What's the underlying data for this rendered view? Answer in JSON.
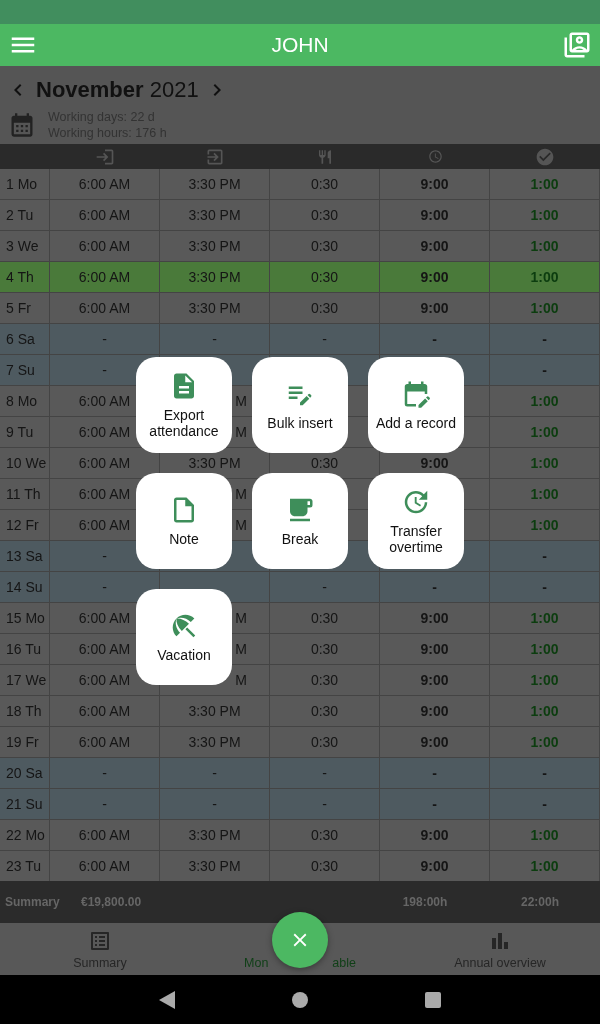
{
  "app_bar": {
    "title": "JOHN"
  },
  "month": {
    "name": "November",
    "year": "2021"
  },
  "stats": [
    {
      "label": "Working days:",
      "value": "22 d"
    },
    {
      "label": "Working hours:",
      "value": "176 h"
    }
  ],
  "table": {
    "rows": [
      {
        "day": "1 Mo",
        "kind": "workday",
        "selected": false,
        "cells": [
          "6:00 AM",
          "3:30 PM",
          "0:30",
          "9:00",
          "1:00"
        ]
      },
      {
        "day": "2 Tu",
        "kind": "workday",
        "selected": false,
        "cells": [
          "6:00 AM",
          "3:30 PM",
          "0:30",
          "9:00",
          "1:00"
        ]
      },
      {
        "day": "3 We",
        "kind": "workday",
        "selected": false,
        "cells": [
          "6:00 AM",
          "3:30 PM",
          "0:30",
          "9:00",
          "1:00"
        ]
      },
      {
        "day": "4 Th",
        "kind": "workday",
        "selected": true,
        "cells": [
          "6:00 AM",
          "3:30 PM",
          "0:30",
          "9:00",
          "1:00"
        ]
      },
      {
        "day": "5 Fr",
        "kind": "workday",
        "selected": false,
        "cells": [
          "6:00 AM",
          "3:30 PM",
          "0:30",
          "9:00",
          "1:00"
        ]
      },
      {
        "day": "6 Sa",
        "kind": "weekend",
        "selected": false,
        "cells": [
          "-",
          "-",
          "-",
          "-",
          "-"
        ]
      },
      {
        "day": "7 Su",
        "kind": "weekend",
        "selected": false,
        "cells": [
          "-",
          null,
          null,
          null,
          "-"
        ]
      },
      {
        "day": "8 Mo",
        "kind": "workday",
        "selected": false,
        "cells": [
          "6:00 AM",
          {
            "text": "M"
          },
          null,
          null,
          "1:00"
        ]
      },
      {
        "day": "9 Tu",
        "kind": "workday",
        "selected": false,
        "cells": [
          "6:00 AM",
          {
            "text": "M"
          },
          null,
          null,
          "1:00"
        ]
      },
      {
        "day": "10 We",
        "kind": "workday",
        "selected": false,
        "cells": [
          "6:00 AM",
          "3:30 PM",
          "0:30",
          "9:00",
          "1:00"
        ]
      },
      {
        "day": "11 Th",
        "kind": "workday",
        "selected": false,
        "cells": [
          "6:00 AM",
          {
            "text": "M"
          },
          null,
          null,
          "1:00"
        ]
      },
      {
        "day": "12 Fr",
        "kind": "workday",
        "selected": false,
        "cells": [
          "6:00 AM",
          {
            "text": "M"
          },
          null,
          null,
          "1:00"
        ]
      },
      {
        "day": "13 Sa",
        "kind": "weekend",
        "selected": false,
        "cells": [
          "-",
          null,
          null,
          null,
          "-"
        ]
      },
      {
        "day": "14 Su",
        "kind": "weekend",
        "selected": false,
        "cells": [
          "-",
          null,
          "-",
          "-",
          "-"
        ]
      },
      {
        "day": "15 Mo",
        "kind": "workday",
        "selected": false,
        "cells": [
          "6:00 AM",
          {
            "text": "M"
          },
          "0:30",
          "9:00",
          "1:00"
        ]
      },
      {
        "day": "16 Tu",
        "kind": "workday",
        "selected": false,
        "cells": [
          "6:00 AM",
          {
            "text": "M"
          },
          "0:30",
          "9:00",
          "1:00"
        ]
      },
      {
        "day": "17 We",
        "kind": "workday",
        "selected": false,
        "cells": [
          "6:00 AM",
          {
            "text": "M"
          },
          "0:30",
          "9:00",
          "1:00"
        ]
      },
      {
        "day": "18 Th",
        "kind": "workday",
        "selected": false,
        "cells": [
          "6:00 AM",
          "3:30 PM",
          "0:30",
          "9:00",
          "1:00"
        ]
      },
      {
        "day": "19 Fr",
        "kind": "workday",
        "selected": false,
        "cells": [
          "6:00 AM",
          "3:30 PM",
          "0:30",
          "9:00",
          "1:00"
        ]
      },
      {
        "day": "20 Sa",
        "kind": "weekend",
        "selected": false,
        "cells": [
          "-",
          "-",
          "-",
          "-",
          "-"
        ]
      },
      {
        "day": "21 Su",
        "kind": "weekend",
        "selected": false,
        "cells": [
          "-",
          "-",
          "-",
          "-",
          "-"
        ]
      },
      {
        "day": "22 Mo",
        "kind": "workday",
        "selected": false,
        "cells": [
          "6:00 AM",
          "3:30 PM",
          "0:30",
          "9:00",
          "1:00"
        ]
      },
      {
        "day": "23 Tu",
        "kind": "workday",
        "selected": false,
        "cells": [
          "6:00 AM",
          "3:30 PM",
          "0:30",
          "9:00",
          "1:00"
        ]
      }
    ]
  },
  "summary": {
    "label": "Summary",
    "amount": "€19,800.00",
    "hours": "198:00h",
    "overtime": "22:00h"
  },
  "bottom_nav": [
    {
      "kind": "summary",
      "label": "Summary",
      "selected": false
    },
    {
      "kind": "table",
      "label": "Mon",
      "label_tail": "able",
      "selected": true
    },
    {
      "kind": "annual",
      "label": "Annual overview",
      "selected": false
    }
  ],
  "menu": [
    {
      "kind": "export",
      "label": "Export attendance"
    },
    {
      "kind": "bulk",
      "label": "Bulk insert"
    },
    {
      "kind": "record",
      "label": "Add a record"
    },
    {
      "kind": "note",
      "label": "Note"
    },
    {
      "kind": "break",
      "label": "Break"
    },
    {
      "kind": "transfer",
      "label": "Transfer overtime"
    },
    {
      "kind": "vacation",
      "label": "Vacation"
    }
  ]
}
